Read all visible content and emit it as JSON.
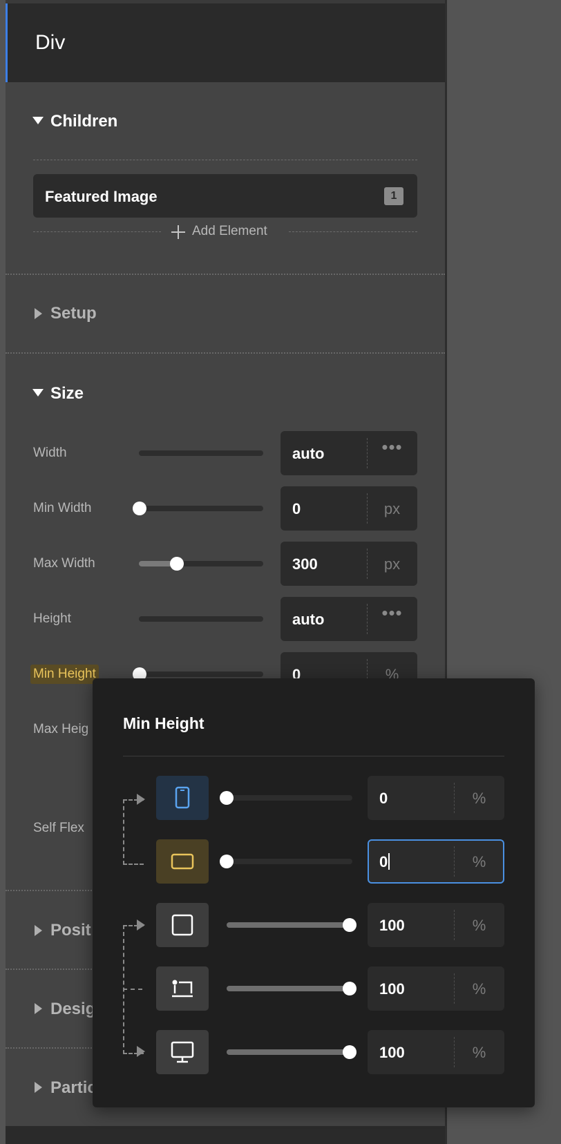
{
  "header": {
    "title": "Div"
  },
  "children_section": {
    "title": "Children",
    "items": [
      {
        "name": "Featured Image",
        "count": "1"
      }
    ],
    "add_label": "Add Element"
  },
  "setup_section": {
    "title": "Setup"
  },
  "size_section": {
    "title": "Size",
    "rows": [
      {
        "label": "Width",
        "value": "auto",
        "unit": "•••",
        "slider": null
      },
      {
        "label": "Min Width",
        "value": "0",
        "unit": "px",
        "slider": 0
      },
      {
        "label": "Max Width",
        "value": "300",
        "unit": "px",
        "slider": 0.3
      },
      {
        "label": "Height",
        "value": "auto",
        "unit": "•••",
        "slider": null
      },
      {
        "label": "Min Height",
        "value": "0",
        "unit": "%",
        "slider": 0
      },
      {
        "label": "Max Heig",
        "value": "",
        "unit": "",
        "slider": null
      },
      {
        "label": "Self Flex",
        "value": "",
        "unit": "",
        "slider": null
      }
    ]
  },
  "collapsed_sections": [
    "Posit",
    "Desig",
    "Partic"
  ],
  "popover": {
    "title": "Min Height",
    "rows": [
      {
        "device": "mobile-portrait-icon",
        "value": "0",
        "unit": "%",
        "slider": 0,
        "state": "active-blue"
      },
      {
        "device": "mobile-landscape-icon",
        "value": "0",
        "unit": "%",
        "slider": 0,
        "state": "active-yellow",
        "focused": true
      },
      {
        "device": "tablet-icon",
        "value": "100",
        "unit": "%",
        "slider": 1,
        "state": "default"
      },
      {
        "device": "laptop-icon",
        "value": "100",
        "unit": "%",
        "slider": 1,
        "state": "default"
      },
      {
        "device": "desktop-icon",
        "value": "100",
        "unit": "%",
        "slider": 1,
        "state": "default"
      }
    ]
  },
  "colors": {
    "accent_blue": "#3d7fe6",
    "highlight_yellow": "#e9c45b",
    "focus_blue": "#4a90e2"
  }
}
